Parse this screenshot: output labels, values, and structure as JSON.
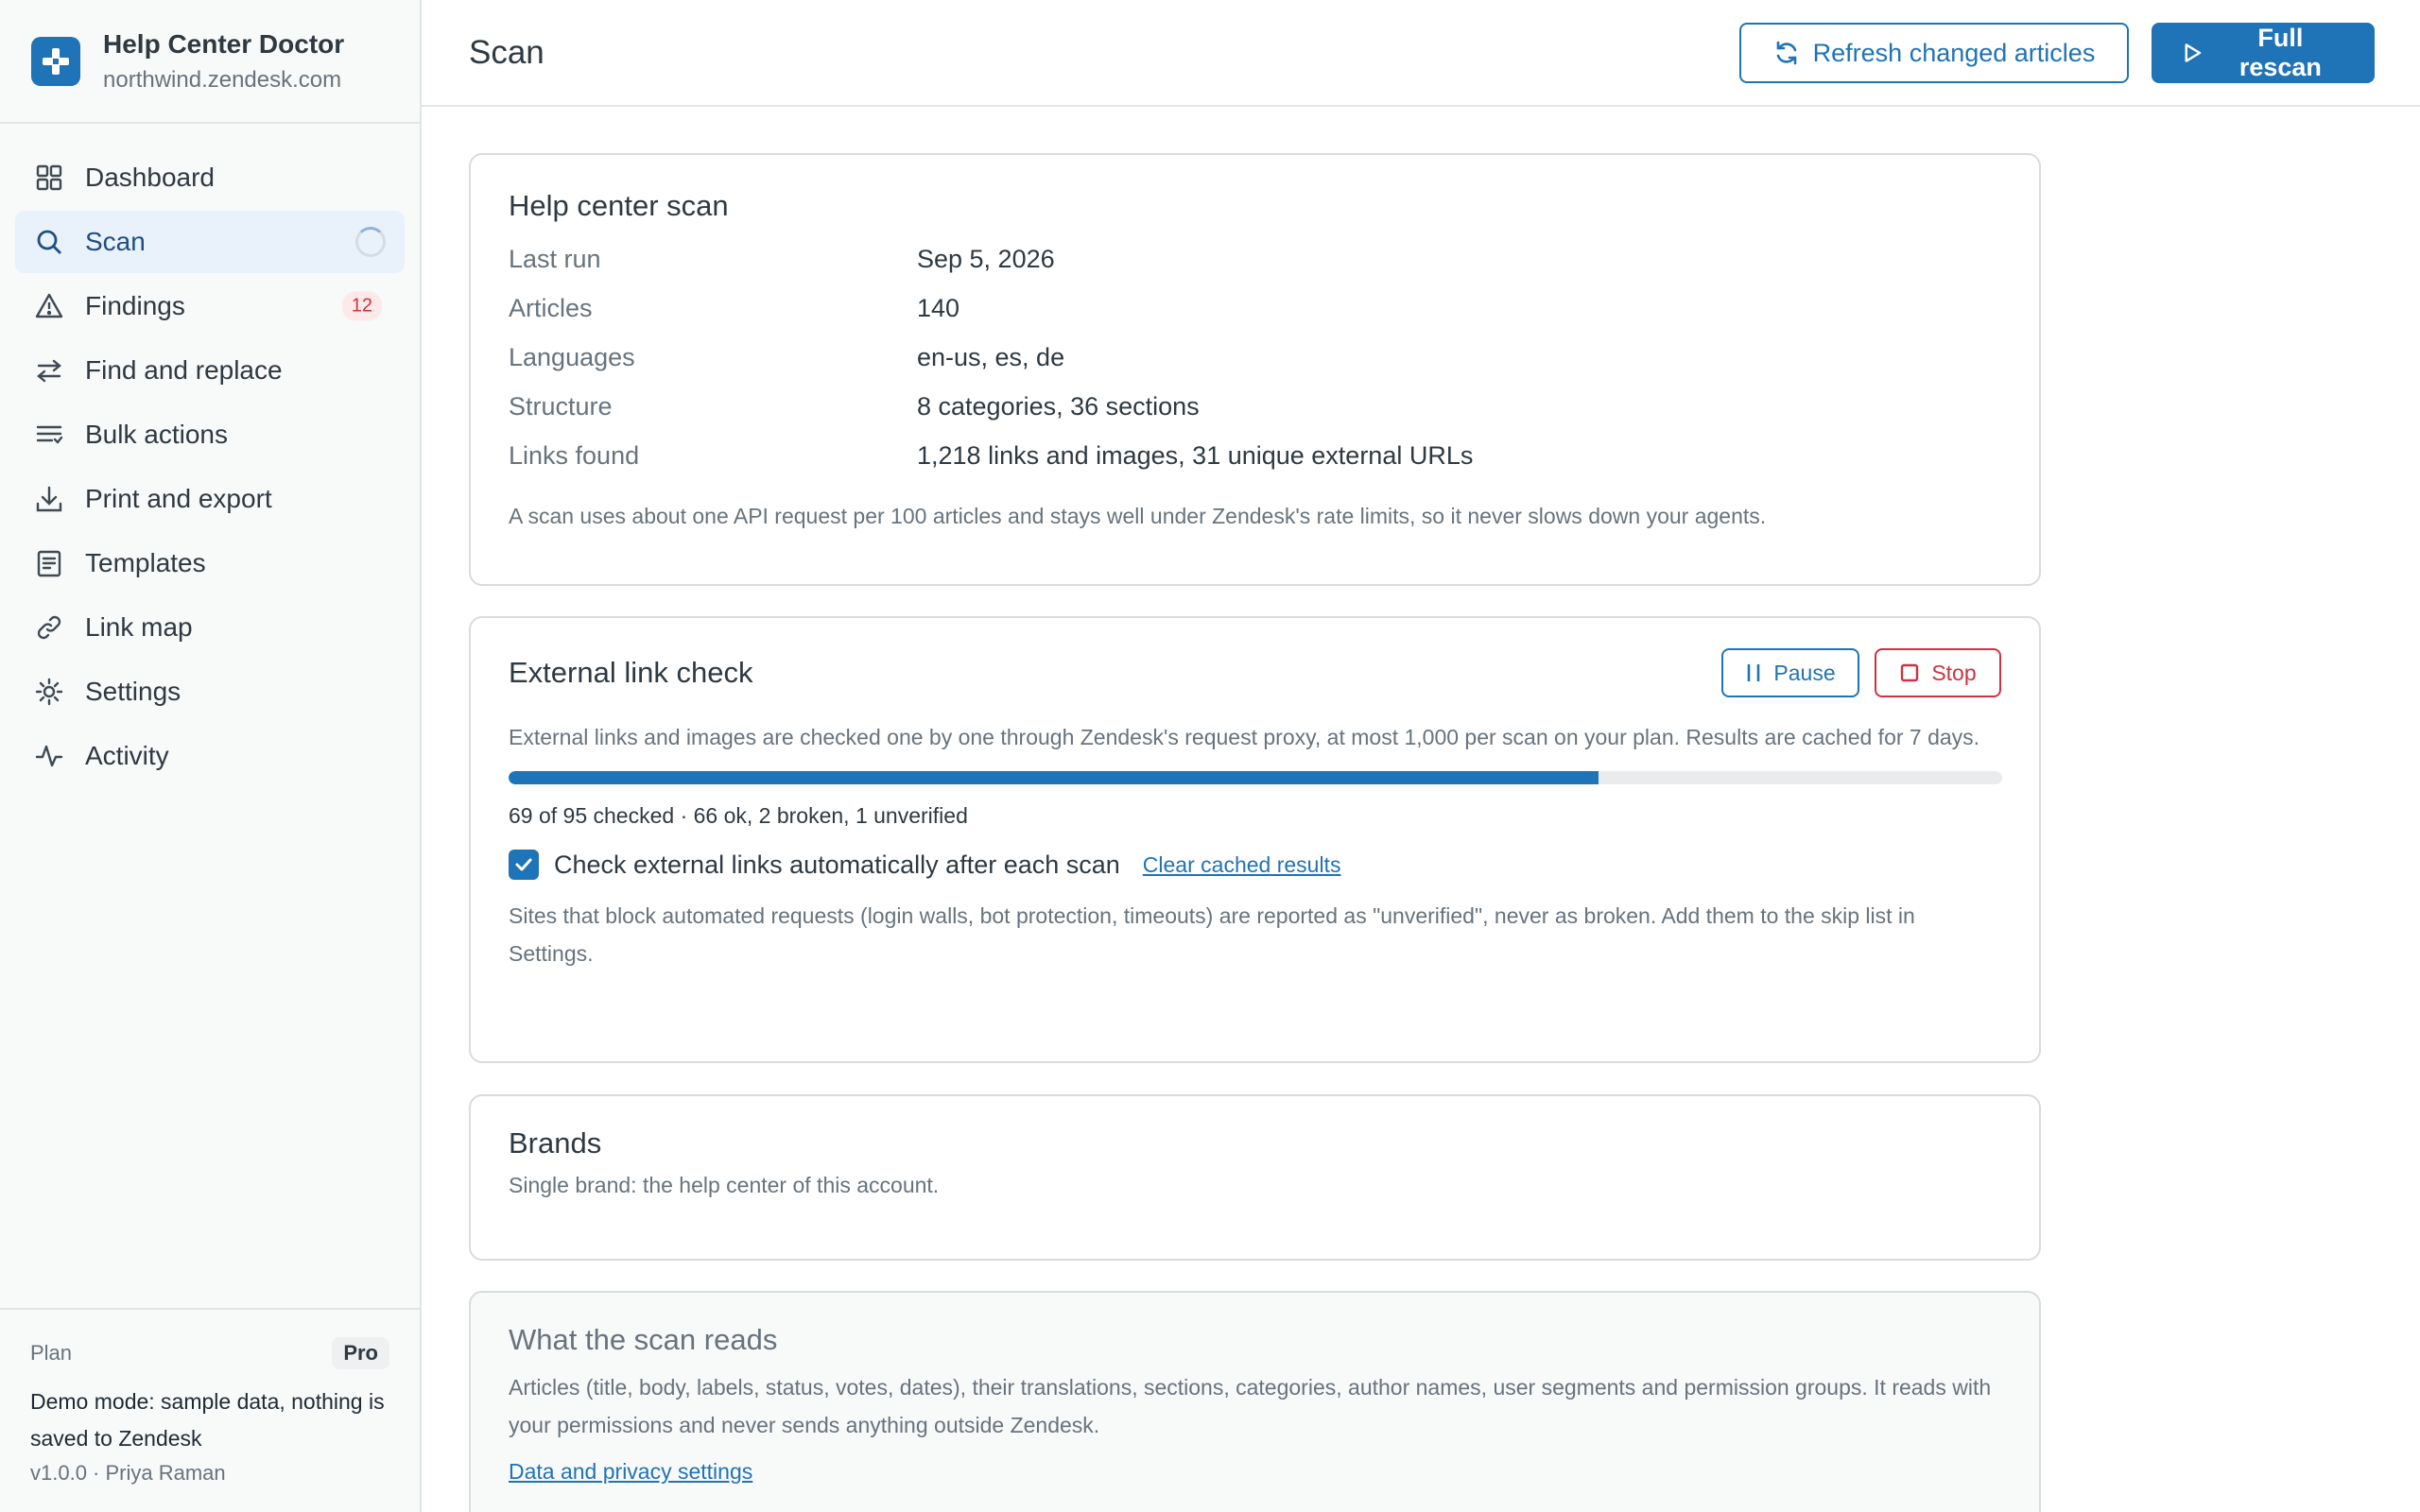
{
  "app": {
    "name": "Help Center Doctor",
    "domain": "northwind.zendesk.com"
  },
  "sidebar": {
    "items": [
      {
        "label": "Dashboard",
        "icon": "grid-icon"
      },
      {
        "label": "Scan",
        "icon": "search-icon",
        "active": true,
        "status": "loading"
      },
      {
        "label": "Findings",
        "icon": "warning-icon",
        "badge": "12"
      },
      {
        "label": "Find and replace",
        "icon": "swap-icon"
      },
      {
        "label": "Bulk actions",
        "icon": "list-icon"
      },
      {
        "label": "Print and export",
        "icon": "download-icon"
      },
      {
        "label": "Templates",
        "icon": "document-icon"
      },
      {
        "label": "Link map",
        "icon": "link-icon"
      },
      {
        "label": "Settings",
        "icon": "gear-icon"
      },
      {
        "label": "Activity",
        "icon": "activity-icon"
      }
    ],
    "footer": {
      "plan_label": "Plan",
      "plan_value": "Pro",
      "demo_note": "Demo mode: sample data, nothing is saved to Zendesk",
      "version": "v1.0.0 · Priya Raman"
    }
  },
  "header": {
    "title": "Scan",
    "refresh_label": "Refresh changed articles",
    "rescan_label": "Full rescan"
  },
  "scan_card": {
    "title": "Help center scan",
    "rows": [
      {
        "key": "Last run",
        "value": "Sep 5, 2026"
      },
      {
        "key": "Articles",
        "value": "140"
      },
      {
        "key": "Languages",
        "value": "en-us, es, de"
      },
      {
        "key": "Structure",
        "value": "8 categories, 36 sections"
      },
      {
        "key": "Links found",
        "value": "1,218 links and images, 31 unique external URLs"
      }
    ],
    "note": "A scan uses about one API request per 100 articles and stays well under Zendesk's rate limits, so it never slows down your agents."
  },
  "external_check": {
    "title": "External link check",
    "pause_label": "Pause",
    "stop_label": "Stop",
    "description": "External links and images are checked one by one through Zendesk's request proxy, at most 1,000 per scan on your plan. Results are cached for 7 days.",
    "progress": 0.73,
    "progress_text": "69 of 95 checked · 66 ok, 2 broken, 1 unverified",
    "auto_check_label": "Check external links automatically after each scan",
    "auto_check_checked": true,
    "clear_cache_label": "Clear cached results",
    "note": "Sites that block automated requests (login walls, bot protection, timeouts) are reported as \"unverified\", never as broken. Add them to the skip list in Settings."
  },
  "brands": {
    "title": "Brands",
    "text": "Single brand: the help center of this account."
  },
  "reads": {
    "title": "What the scan reads",
    "text": "Articles (title, body, labels, status, votes, dates), their translations, sections, categories, author names, user segments and permission groups. It reads with your permissions and never sends anything outside Zendesk.",
    "link_label": "Data and privacy settings"
  },
  "colors": {
    "accent": "#1f73b7",
    "danger": "#cc3340",
    "active_nav_bg": "#e9f1fa"
  }
}
